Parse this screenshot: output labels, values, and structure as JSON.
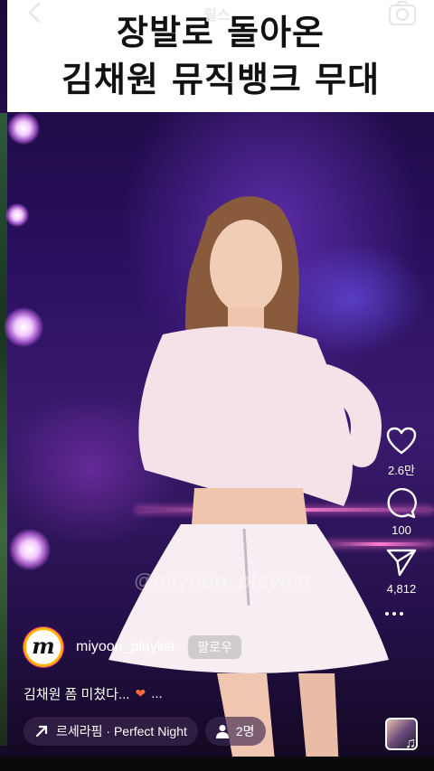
{
  "nav": {
    "title": "릴스"
  },
  "header": {
    "line1": "장발로 돌아온",
    "line2": "김채원 뮤직뱅크 무대"
  },
  "video": {
    "watermark": "@miyoon_playlist"
  },
  "actions": {
    "likes": "2.6만",
    "comments": "100",
    "shares": "4,812"
  },
  "author": {
    "avatar_letter": "m",
    "username": "miyoon_playlist",
    "follow_label": "팔로우"
  },
  "caption": {
    "text": "김채원 폼 미쳤다...",
    "more": "..."
  },
  "audio": {
    "label": "르세라핌 · Perfect Night"
  },
  "people": {
    "label": "2명"
  },
  "colors": {
    "header_bg": "#ffffff",
    "avatar_ring": "#ffb400",
    "accent": "#ff7fd5"
  }
}
